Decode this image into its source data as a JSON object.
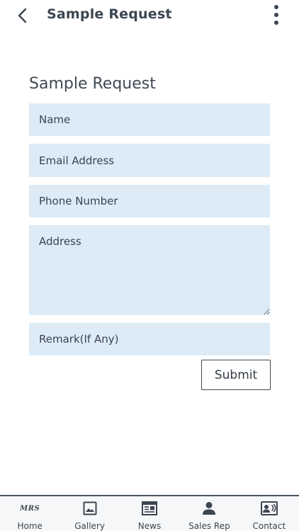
{
  "app_bar": {
    "title": "Sample Request",
    "back_icon": "chevron-left-icon",
    "menu_icon": "more-vertical-icon"
  },
  "form": {
    "title": "Sample Request",
    "fields": {
      "name": {
        "placeholder": "Name",
        "value": ""
      },
      "email": {
        "placeholder": "Email Address",
        "value": ""
      },
      "phone": {
        "placeholder": "Phone Number",
        "value": ""
      },
      "address": {
        "placeholder": "Address",
        "value": ""
      },
      "remark": {
        "placeholder": "Remark(If Any)",
        "value": ""
      }
    },
    "submit_label": "Submit"
  },
  "bottom_nav": {
    "home_mark": "ΜRS",
    "items": [
      {
        "label": "Home",
        "icon": "home-logo-icon"
      },
      {
        "label": "Gallery",
        "icon": "image-icon"
      },
      {
        "label": "News",
        "icon": "newspaper-icon"
      },
      {
        "label": "Sales Rep",
        "icon": "person-icon"
      },
      {
        "label": "Contact",
        "icon": "contact-card-icon"
      }
    ]
  },
  "colors": {
    "field_background": "#dcebf6",
    "text": "#333b45",
    "nav_background": "#f6f7f8",
    "nav_border": "#4a5561"
  }
}
